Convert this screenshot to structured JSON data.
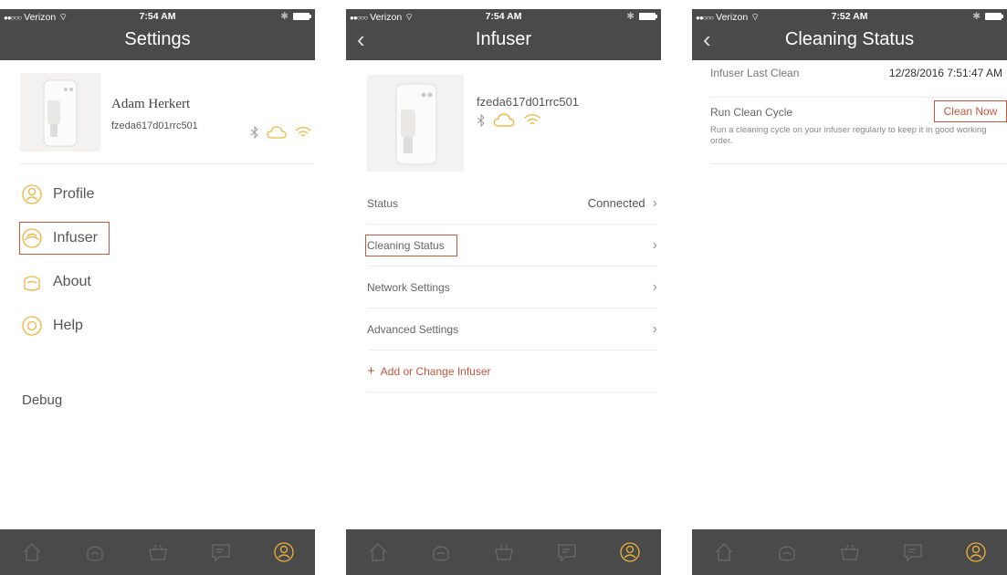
{
  "screens": [
    {
      "status": {
        "carrier": "Verizon",
        "time": "7:54 AM"
      },
      "title": "Settings",
      "profile": {
        "name": "Adam Herkert",
        "device_id": "fzeda617d01rrc501"
      },
      "menu": [
        {
          "label": "Profile",
          "icon": "profile-icon"
        },
        {
          "label": "Infuser",
          "icon": "infuser-icon"
        },
        {
          "label": "About",
          "icon": "about-icon"
        },
        {
          "label": "Help",
          "icon": "help-icon"
        }
      ],
      "debug": "Debug"
    },
    {
      "status": {
        "carrier": "Verizon",
        "time": "7:54 AM"
      },
      "title": "Infuser",
      "device_id": "fzeda617d01rrc501",
      "rows": [
        {
          "label": "Status",
          "value": "Connected"
        },
        {
          "label": "Cleaning Status",
          "value": ""
        },
        {
          "label": "Network Settings",
          "value": ""
        },
        {
          "label": "Advanced Settings",
          "value": ""
        }
      ],
      "add_label": "Add or Change Infuser"
    },
    {
      "status": {
        "carrier": "Verizon",
        "time": "7:52 AM"
      },
      "title": "Cleaning Status",
      "last_clean": {
        "label": "Infuser Last Clean",
        "value": "12/28/2016 7:51:47 AM"
      },
      "clean_cycle": {
        "title": "Run Clean Cycle",
        "button": "Clean Now",
        "description": "Run a cleaning cycle on your infuser regularly to keep it in good working order."
      }
    }
  ],
  "tabs": [
    {
      "name": "home-icon"
    },
    {
      "name": "leaf-icon"
    },
    {
      "name": "basket-icon"
    },
    {
      "name": "chat-icon"
    },
    {
      "name": "account-icon"
    }
  ],
  "colors": {
    "bar": "#4a4a4a",
    "accent": "#f0b33a",
    "highlight": "#c8553d"
  }
}
